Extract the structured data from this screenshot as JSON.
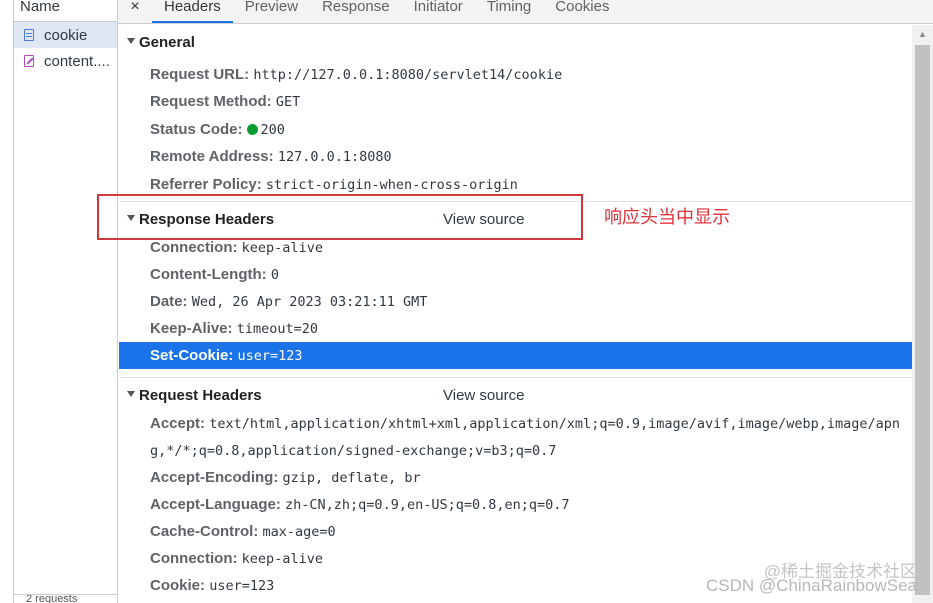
{
  "sidebar": {
    "header": "Name",
    "requests": [
      {
        "name": "cookie",
        "icon": "document-icon"
      },
      {
        "name": "content....",
        "icon": "edit-icon"
      }
    ],
    "footer": "2 requests"
  },
  "tabs": {
    "close": "×",
    "items": [
      "Headers",
      "Preview",
      "Response",
      "Initiator",
      "Timing",
      "Cookies"
    ],
    "active": "Headers"
  },
  "general": {
    "title": "General",
    "rows": [
      {
        "key": "Request URL:",
        "value": "http://127.0.0.1:8080/servlet14/cookie"
      },
      {
        "key": "Request Method:",
        "value": "GET"
      },
      {
        "key": "Status Code:",
        "value": "200",
        "status_color": "#0a9d2f"
      },
      {
        "key": "Remote Address:",
        "value": "127.0.0.1:8080"
      },
      {
        "key": "Referrer Policy:",
        "value": "strict-origin-when-cross-origin"
      }
    ]
  },
  "response_headers": {
    "title": "Response Headers",
    "view_source": "View source",
    "rows": [
      {
        "key": "Connection:",
        "value": "keep-alive"
      },
      {
        "key": "Content-Length:",
        "value": "0"
      },
      {
        "key": "Date:",
        "value": "Wed, 26 Apr 2023 03:21:11 GMT"
      },
      {
        "key": "Keep-Alive:",
        "value": "timeout=20"
      },
      {
        "key": "Set-Cookie:",
        "value": "user=123"
      }
    ]
  },
  "request_headers": {
    "title": "Request Headers",
    "view_source": "View source",
    "rows": [
      {
        "key": "Accept:",
        "value": "text/html,application/xhtml+xml,application/xml;q=0.9,image/avif,image/webp,image/apn",
        "cont": "g,*/*;q=0.8,application/signed-exchange;v=b3;q=0.7"
      },
      {
        "key": "Accept-Encoding:",
        "value": "gzip, deflate, br"
      },
      {
        "key": "Accept-Language:",
        "value": "zh-CN,zh;q=0.9,en-US;q=0.8,en;q=0.7"
      },
      {
        "key": "Cache-Control:",
        "value": "max-age=0"
      },
      {
        "key": "Connection:",
        "value": "keep-alive"
      },
      {
        "key": "Cookie:",
        "value": "user=123"
      }
    ]
  },
  "annotation": {
    "text": "响应头当中显示",
    "color": "#d1383e"
  },
  "watermark": {
    "line1": "@稀土掘金技术社区",
    "line2": "CSDN @ChinaRainbowSea"
  },
  "colors": {
    "accent": "#1a73e8",
    "status_ok": "#0a9d2f"
  }
}
